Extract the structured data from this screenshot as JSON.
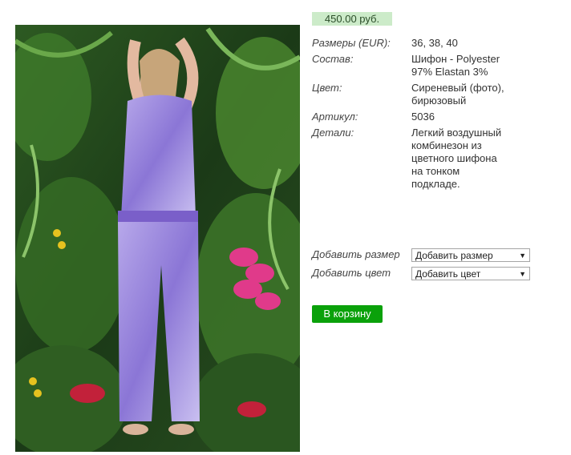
{
  "product": {
    "price": "450.00 руб.",
    "specs": [
      {
        "label": "Размеры (EUR):",
        "value": "36, 38, 40"
      },
      {
        "label": "Состав:",
        "value": "Шифон - Polyester 97% Elastan 3%"
      },
      {
        "label": "Цвет:",
        "value": "Сиреневый (фото), бирюзовый"
      },
      {
        "label": "Артикул:",
        "value": "5036"
      },
      {
        "label": "Детали:",
        "value": "Легкий воздушный комбинезон из цветного шифона на тонком подкладе."
      }
    ]
  },
  "form": {
    "size_label": "Добавить размер",
    "size_select": "Добавить размер",
    "color_label": "Добавить цвет",
    "color_select": "Добавить цвет",
    "cart_button": "В корзину"
  },
  "colors": {
    "price_bg": "#ccebc9",
    "cart_button": "#0aa10a",
    "outfit": "#9b87d8"
  },
  "icons": {
    "dropdown": "triangle-down-icon"
  }
}
